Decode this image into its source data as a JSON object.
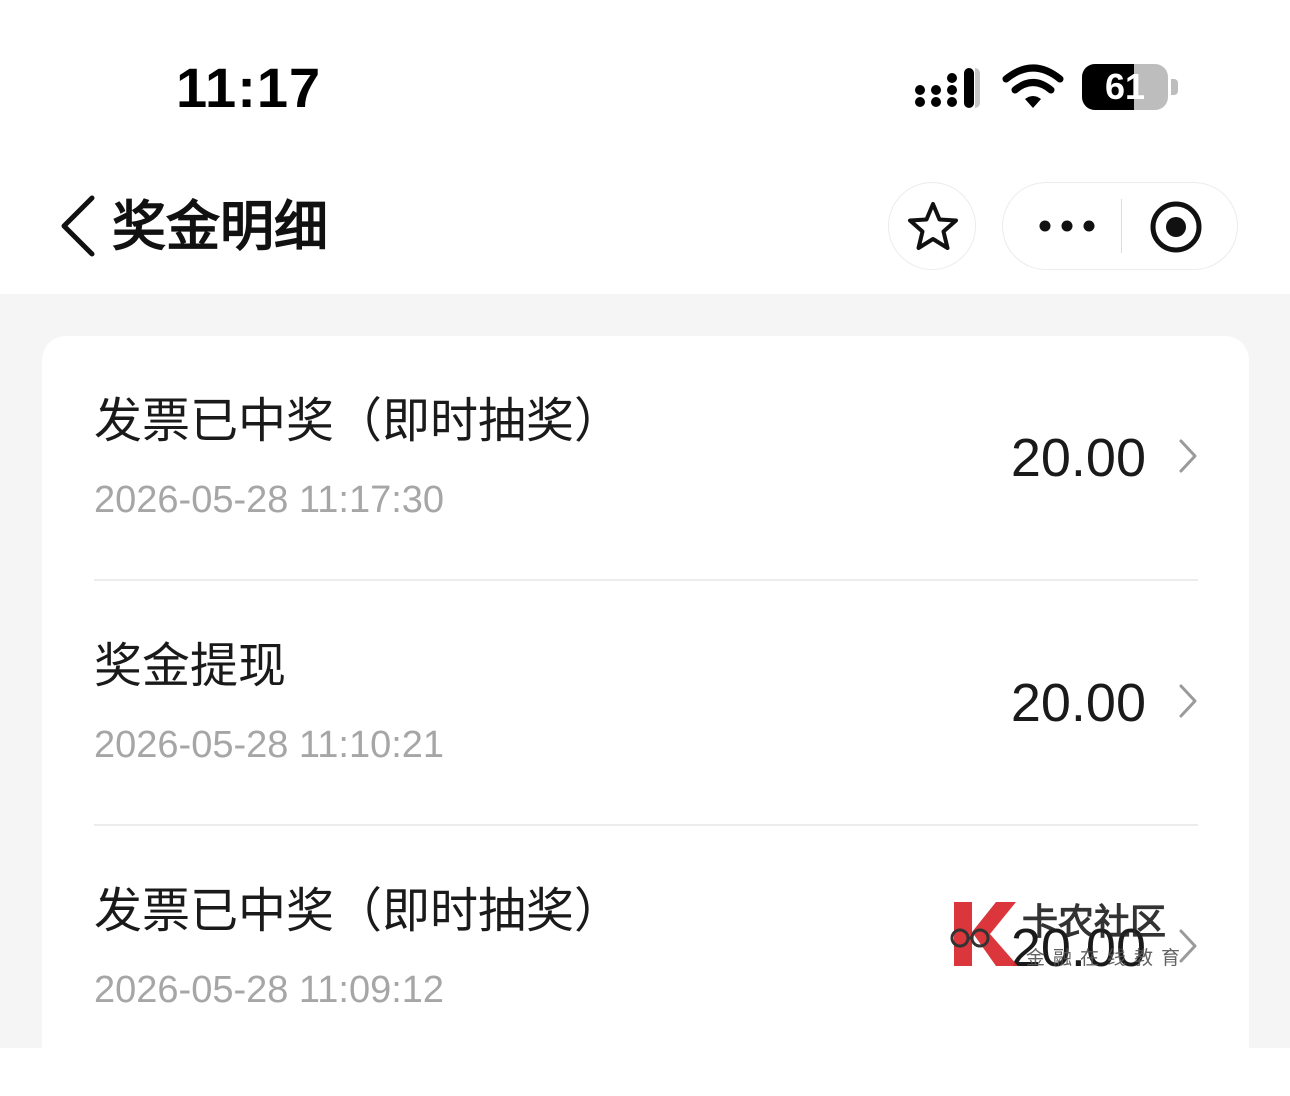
{
  "status_bar": {
    "time": "11:17",
    "battery_level": "61"
  },
  "nav": {
    "title": "奖金明细",
    "back_icon": "chevron-left-icon",
    "favorite_icon": "star-outline-icon",
    "more_icon": "more-dots-icon",
    "close_icon": "target-circle-icon"
  },
  "records": [
    {
      "title": "发票已中奖（即时抽奖）",
      "time": "2026-05-28 11:17:30",
      "amount": "20.00"
    },
    {
      "title": "奖金提现",
      "time": "2026-05-28 11:10:21",
      "amount": "20.00"
    },
    {
      "title": "发票已中奖（即时抽奖）",
      "time": "2026-05-28 11:09:12",
      "amount": "20.00"
    }
  ],
  "watermark": {
    "main_text": "卡农社区",
    "sub_text": "金融在线教育"
  },
  "colors": {
    "page_background": "#f5f5f5",
    "card_background": "#ffffff",
    "primary_text": "#1a1a1a",
    "secondary_text": "#a6a6a6",
    "divider": "#ececec",
    "watermark_red": "#d9262b"
  }
}
